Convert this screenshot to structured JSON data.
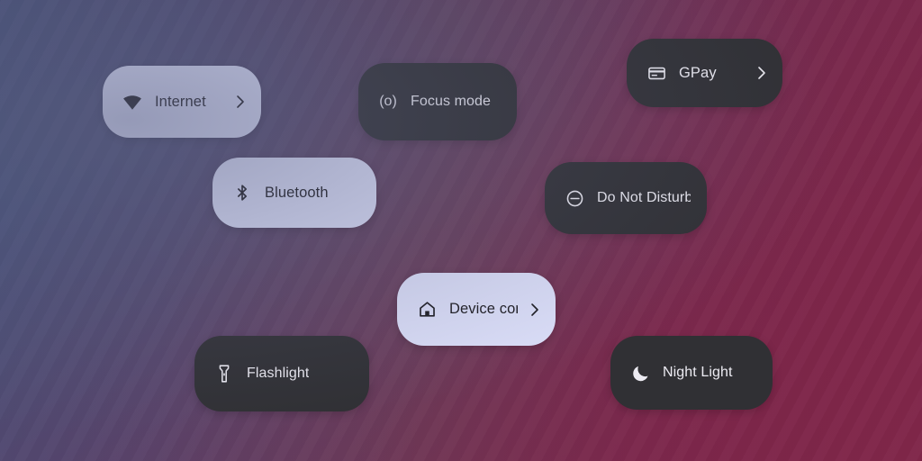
{
  "wallpaper": {
    "description": "gradient wallpaper",
    "color_top_left": "#5d5d75",
    "color_top_right": "#802a4b",
    "color_bottom_left": "#53627e",
    "color_bottom_right": "#7d3356",
    "color_center": "#6e4f63"
  },
  "theme": {
    "tile_light_bg": "#dde0fa",
    "tile_light_fg": "#1c1b20",
    "tile_dark_bg": "#303034",
    "tile_dark_fg": "#ecebf2"
  },
  "tiles": [
    {
      "id": "internet",
      "label": "Internet",
      "icon": "wifi-icon",
      "style": "light",
      "chevron": ">",
      "has_chevron": true
    },
    {
      "id": "focus-mode",
      "label": "Focus mode",
      "icon": "focus-mode-icon",
      "icon_glyph": "(o)",
      "style": "dark",
      "chevron": "",
      "has_chevron": false
    },
    {
      "id": "gpay",
      "label": "GPay",
      "icon": "credit-card-icon",
      "style": "dark",
      "chevron": ">",
      "has_chevron": true
    },
    {
      "id": "bluetooth",
      "label": "Bluetooth",
      "icon": "bluetooth-icon",
      "style": "light",
      "chevron": "",
      "has_chevron": false
    },
    {
      "id": "do-not-disturb",
      "label": "Do Not Disturb",
      "icon": "do-not-disturb-icon",
      "style": "dark",
      "chevron": "",
      "has_chevron": false
    },
    {
      "id": "device-controls",
      "label": "Device controls",
      "icon": "home-icon",
      "style": "light",
      "chevron": ">",
      "has_chevron": true,
      "label_clipped": true
    },
    {
      "id": "flashlight",
      "label": "Flashlight",
      "icon": "flashlight-icon",
      "style": "dark",
      "chevron": "",
      "has_chevron": false
    },
    {
      "id": "night-light",
      "label": "Night Light",
      "icon": "moon-icon",
      "style": "dark",
      "chevron": "",
      "has_chevron": false
    }
  ]
}
